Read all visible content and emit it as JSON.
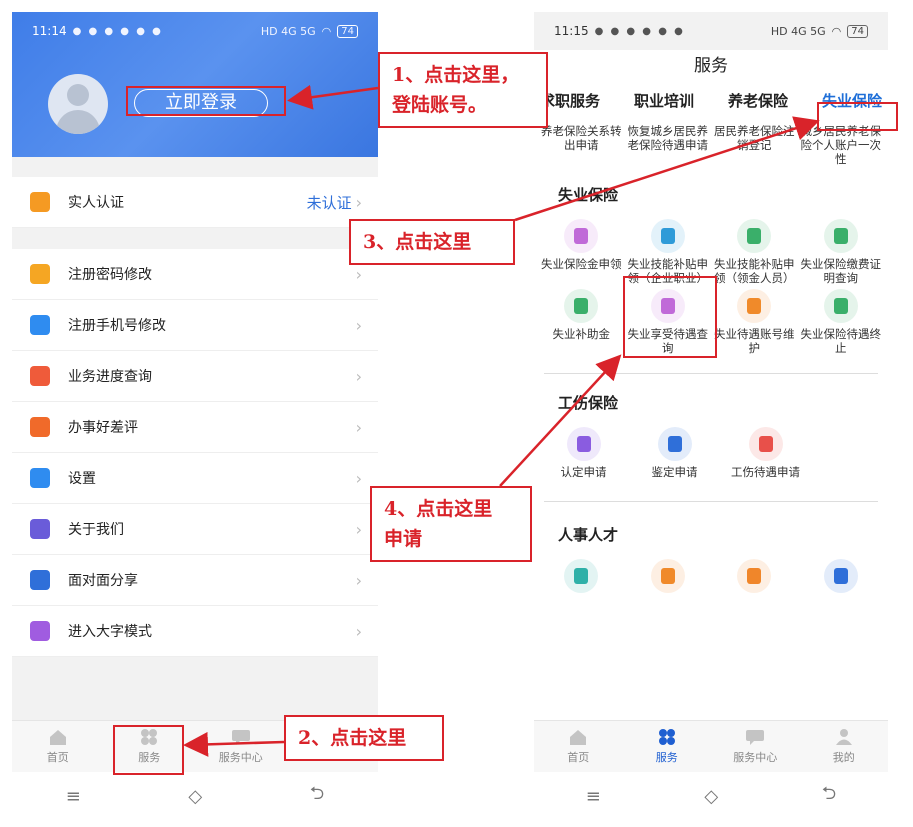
{
  "left": {
    "status": {
      "time": "11:14",
      "net": "HD 4G 5G",
      "battery": "74"
    },
    "header": {
      "login_label": "立即登录"
    },
    "menu_top": [
      {
        "label": "实人认证",
        "value": "未认证",
        "icon": "id-card-icon",
        "color": "#f59a23"
      }
    ],
    "menu": [
      {
        "label": "注册密码修改",
        "icon": "lock-icon",
        "color": "#f5a623"
      },
      {
        "label": "注册手机号修改",
        "icon": "phone-icon",
        "color": "#2f8cf0"
      },
      {
        "label": "业务进度查询",
        "icon": "hourglass-icon",
        "color": "#ef5b3a"
      },
      {
        "label": "办事好差评",
        "icon": "lotus-icon",
        "color": "#f06a2a"
      },
      {
        "label": "设置",
        "icon": "gear-icon",
        "color": "#2f8cf0"
      },
      {
        "label": "关于我们",
        "icon": "info-icon",
        "color": "#6a5cd9"
      },
      {
        "label": "面对面分享",
        "icon": "share-user-icon",
        "color": "#2f6fd9"
      },
      {
        "label": "进入大字模式",
        "icon": "big-font-icon",
        "color": "#a05ce0"
      }
    ],
    "tabs": [
      "首页",
      "服务",
      "服务中心"
    ]
  },
  "right": {
    "status": {
      "time": "11:15",
      "net": "HD 4G 5G",
      "battery": "74"
    },
    "title": "服务",
    "tabs": [
      "求职服务",
      "职业培训",
      "养老保险",
      "失业保险"
    ],
    "pension_row": [
      "养老保险关系转出申请",
      "恢复城乡居民养老保险待遇申请",
      "居民养老保险注销登记",
      "城乡居民养老保险个人账户一次性"
    ],
    "unemployment": {
      "title": "失业保险",
      "items": [
        "失业保险金申领",
        "失业技能补贴申领（企业职业）",
        "失业技能补贴申领（领金人员）",
        "失业保险缴费证明查询",
        "失业补助金",
        "失业享受待遇查询",
        "失业待遇账号维护",
        "失业保险待遇终止"
      ],
      "colors": [
        "#c06ad8",
        "#2f9bd8",
        "#3aaf6a",
        "#3aaf6a",
        "#3aaf6a",
        "#c06ad8",
        "#f08a2a",
        "#3aaf6a"
      ]
    },
    "injury": {
      "title": "工伤保险",
      "items": [
        "认定申请",
        "鉴定申请",
        "工伤待遇申请"
      ],
      "colors": [
        "#8a5ce0",
        "#2f6fd9",
        "#e8504a"
      ]
    },
    "talent": {
      "title": "人事人才",
      "colors": [
        "#2fb0a8",
        "#f08a2a",
        "#f0862a",
        "#2f6fd9"
      ]
    },
    "tabs_bottom": [
      "首页",
      "服务",
      "服务中心",
      "我的"
    ]
  },
  "annotations": {
    "a1_line1": "1、点击这里，",
    "a1_line2": "登陆账号。",
    "a2": "2、点击这里",
    "a3": "3、点击这里",
    "a4_line1": "4、点击这里",
    "a4_line2": "申请"
  }
}
